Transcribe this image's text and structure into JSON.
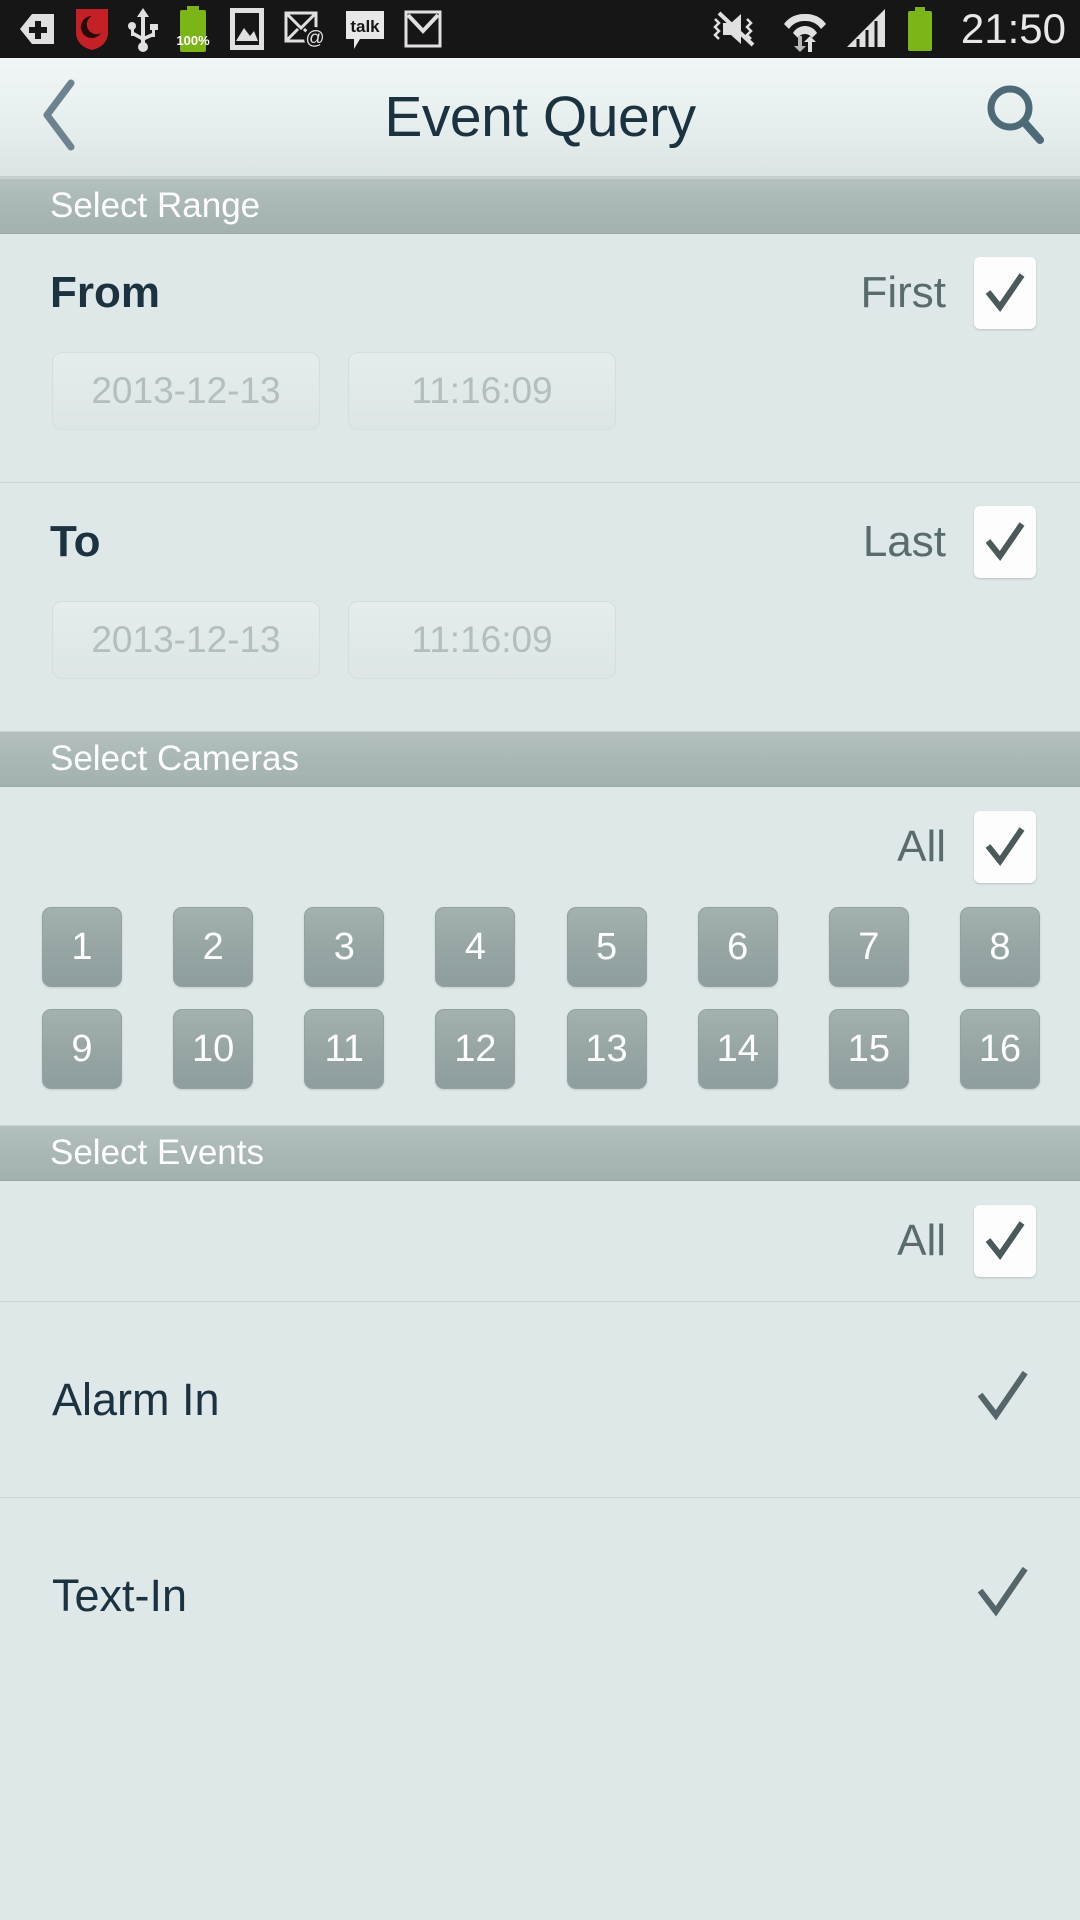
{
  "statusbar": {
    "time": "21:50",
    "battery_text": "100%",
    "icons_left": [
      "add-plus-icon",
      "shield-red-icon",
      "usb-icon",
      "battery-charging-icon",
      "gallery-image-icon",
      "email-at-icon",
      "talk-icon",
      "gmail-icon"
    ],
    "icons_right": [
      "mute-vibrate-off-icon",
      "wifi-data-transfer-icon",
      "cellular-signal-icon",
      "battery-icon"
    ]
  },
  "header": {
    "title": "Event Query",
    "back_icon": "chevron-left-icon",
    "search_icon": "search-icon"
  },
  "sections": {
    "range": {
      "title": "Select Range",
      "rows": [
        {
          "label": "From",
          "checkbox_label": "First",
          "checked": true,
          "date": "2013-12-13",
          "time": "11:16:09"
        },
        {
          "label": "To",
          "checkbox_label": "Last",
          "checked": true,
          "date": "2013-12-13",
          "time": "11:16:09"
        }
      ]
    },
    "cameras": {
      "title": "Select Cameras",
      "all_label": "All",
      "all_checked": true,
      "row1": [
        "1",
        "2",
        "3",
        "4",
        "5",
        "6",
        "7",
        "8"
      ],
      "row2": [
        "9",
        "10",
        "11",
        "12",
        "13",
        "14",
        "15",
        "16"
      ]
    },
    "events": {
      "title": "Select Events",
      "all_label": "All",
      "all_checked": true,
      "items": [
        {
          "label": "Alarm In",
          "checked": true
        },
        {
          "label": "Text-In",
          "checked": true
        }
      ]
    }
  },
  "colors": {
    "statusbar_bg": "#161616",
    "header_text": "#1b3240",
    "section_header_bg": "#a9b6b6",
    "content_bg": "#dfe8e8",
    "camera_button": "#97a5a5",
    "check_mark": "#4a5a5a",
    "battery_green": "#7cb518"
  }
}
